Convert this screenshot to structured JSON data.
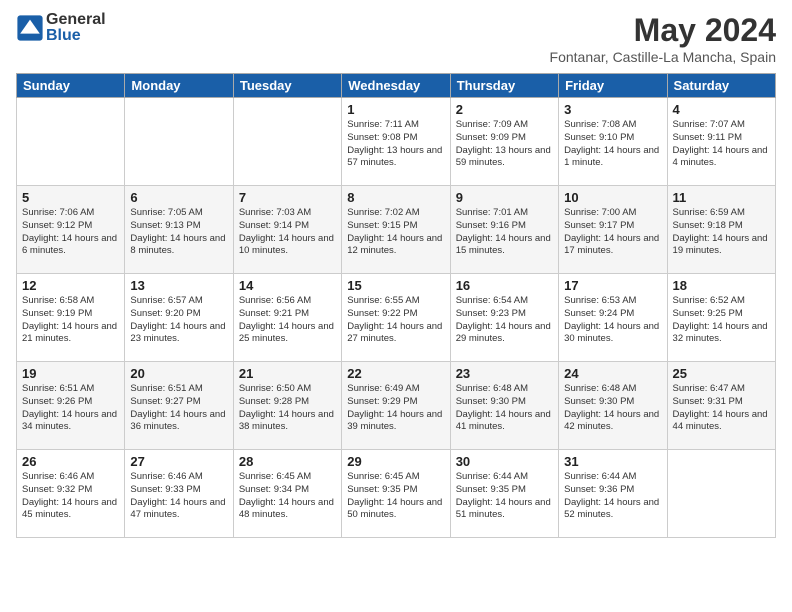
{
  "header": {
    "logo_general": "General",
    "logo_blue": "Blue",
    "month_title": "May 2024",
    "location": "Fontanar, Castille-La Mancha, Spain"
  },
  "days_of_week": [
    "Sunday",
    "Monday",
    "Tuesday",
    "Wednesday",
    "Thursday",
    "Friday",
    "Saturday"
  ],
  "weeks": [
    [
      {
        "day": "",
        "info": ""
      },
      {
        "day": "",
        "info": ""
      },
      {
        "day": "",
        "info": ""
      },
      {
        "day": "1",
        "info": "Sunrise: 7:11 AM\nSunset: 9:08 PM\nDaylight: 13 hours and 57 minutes."
      },
      {
        "day": "2",
        "info": "Sunrise: 7:09 AM\nSunset: 9:09 PM\nDaylight: 13 hours and 59 minutes."
      },
      {
        "day": "3",
        "info": "Sunrise: 7:08 AM\nSunset: 9:10 PM\nDaylight: 14 hours and 1 minute."
      },
      {
        "day": "4",
        "info": "Sunrise: 7:07 AM\nSunset: 9:11 PM\nDaylight: 14 hours and 4 minutes."
      }
    ],
    [
      {
        "day": "5",
        "info": "Sunrise: 7:06 AM\nSunset: 9:12 PM\nDaylight: 14 hours and 6 minutes."
      },
      {
        "day": "6",
        "info": "Sunrise: 7:05 AM\nSunset: 9:13 PM\nDaylight: 14 hours and 8 minutes."
      },
      {
        "day": "7",
        "info": "Sunrise: 7:03 AM\nSunset: 9:14 PM\nDaylight: 14 hours and 10 minutes."
      },
      {
        "day": "8",
        "info": "Sunrise: 7:02 AM\nSunset: 9:15 PM\nDaylight: 14 hours and 12 minutes."
      },
      {
        "day": "9",
        "info": "Sunrise: 7:01 AM\nSunset: 9:16 PM\nDaylight: 14 hours and 15 minutes."
      },
      {
        "day": "10",
        "info": "Sunrise: 7:00 AM\nSunset: 9:17 PM\nDaylight: 14 hours and 17 minutes."
      },
      {
        "day": "11",
        "info": "Sunrise: 6:59 AM\nSunset: 9:18 PM\nDaylight: 14 hours and 19 minutes."
      }
    ],
    [
      {
        "day": "12",
        "info": "Sunrise: 6:58 AM\nSunset: 9:19 PM\nDaylight: 14 hours and 21 minutes."
      },
      {
        "day": "13",
        "info": "Sunrise: 6:57 AM\nSunset: 9:20 PM\nDaylight: 14 hours and 23 minutes."
      },
      {
        "day": "14",
        "info": "Sunrise: 6:56 AM\nSunset: 9:21 PM\nDaylight: 14 hours and 25 minutes."
      },
      {
        "day": "15",
        "info": "Sunrise: 6:55 AM\nSunset: 9:22 PM\nDaylight: 14 hours and 27 minutes."
      },
      {
        "day": "16",
        "info": "Sunrise: 6:54 AM\nSunset: 9:23 PM\nDaylight: 14 hours and 29 minutes."
      },
      {
        "day": "17",
        "info": "Sunrise: 6:53 AM\nSunset: 9:24 PM\nDaylight: 14 hours and 30 minutes."
      },
      {
        "day": "18",
        "info": "Sunrise: 6:52 AM\nSunset: 9:25 PM\nDaylight: 14 hours and 32 minutes."
      }
    ],
    [
      {
        "day": "19",
        "info": "Sunrise: 6:51 AM\nSunset: 9:26 PM\nDaylight: 14 hours and 34 minutes."
      },
      {
        "day": "20",
        "info": "Sunrise: 6:51 AM\nSunset: 9:27 PM\nDaylight: 14 hours and 36 minutes."
      },
      {
        "day": "21",
        "info": "Sunrise: 6:50 AM\nSunset: 9:28 PM\nDaylight: 14 hours and 38 minutes."
      },
      {
        "day": "22",
        "info": "Sunrise: 6:49 AM\nSunset: 9:29 PM\nDaylight: 14 hours and 39 minutes."
      },
      {
        "day": "23",
        "info": "Sunrise: 6:48 AM\nSunset: 9:30 PM\nDaylight: 14 hours and 41 minutes."
      },
      {
        "day": "24",
        "info": "Sunrise: 6:48 AM\nSunset: 9:30 PM\nDaylight: 14 hours and 42 minutes."
      },
      {
        "day": "25",
        "info": "Sunrise: 6:47 AM\nSunset: 9:31 PM\nDaylight: 14 hours and 44 minutes."
      }
    ],
    [
      {
        "day": "26",
        "info": "Sunrise: 6:46 AM\nSunset: 9:32 PM\nDaylight: 14 hours and 45 minutes."
      },
      {
        "day": "27",
        "info": "Sunrise: 6:46 AM\nSunset: 9:33 PM\nDaylight: 14 hours and 47 minutes."
      },
      {
        "day": "28",
        "info": "Sunrise: 6:45 AM\nSunset: 9:34 PM\nDaylight: 14 hours and 48 minutes."
      },
      {
        "day": "29",
        "info": "Sunrise: 6:45 AM\nSunset: 9:35 PM\nDaylight: 14 hours and 50 minutes."
      },
      {
        "day": "30",
        "info": "Sunrise: 6:44 AM\nSunset: 9:35 PM\nDaylight: 14 hours and 51 minutes."
      },
      {
        "day": "31",
        "info": "Sunrise: 6:44 AM\nSunset: 9:36 PM\nDaylight: 14 hours and 52 minutes."
      },
      {
        "day": "",
        "info": ""
      }
    ]
  ]
}
